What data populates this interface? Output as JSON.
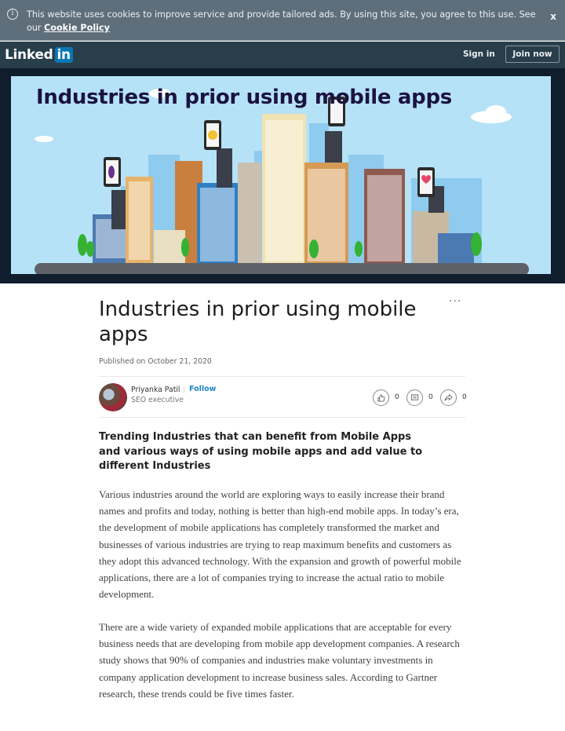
{
  "cookie_banner": {
    "info_icon": "info-circle-icon",
    "text": "This website uses cookies to improve service and provide tailored ads. By using this site, you agree to this use. See our ",
    "link_label": "Cookie Policy",
    "close_label": "x"
  },
  "nav": {
    "logo_text": "Linked",
    "logo_badge": "in",
    "sign_in_label": "Sign in",
    "join_now_label": "Join now"
  },
  "hero": {
    "banner_title": "Industries in prior using mobile apps",
    "colors": {
      "sky": "#b6e2f7",
      "frame": "#0f1d2c",
      "title": "#1a1340"
    }
  },
  "article": {
    "more_icon": "more-horizontal-icon",
    "more_label": "...",
    "title": "Industries in prior using mobile apps",
    "published": "Published on October 21, 2020",
    "author": {
      "name": "Priyanka Patil",
      "follow_label": "Follow",
      "role": "SEO executive"
    },
    "social": [
      {
        "icon": "like-icon",
        "count": "0"
      },
      {
        "icon": "comment-icon",
        "count": "0"
      },
      {
        "icon": "share-icon",
        "count": "0"
      }
    ],
    "subheading": "Trending Industries that can benefit from Mobile Apps and various ways of using mobile apps and add value to different Industries",
    "paragraphs": [
      "Various industries around the world are exploring ways to easily increase their brand names and profits and today, nothing is better than high-end mobile apps. In today’s era, the development of mobile applications has completely transformed the market and businesses of various industries are trying to reap maximum benefits and customers as they adopt this advanced technology. With the expansion and growth of powerful mobile applications, there are a lot of companies trying to increase the actual ratio to mobile development.",
      "There are a wide variety of expanded mobile applications that are acceptable for every business needs that are developing from mobile app development companies. A research study shows that 90% of companies and industries make voluntary investments in company application development to increase business sales. According to Gartner research, these trends could be five times faster."
    ]
  },
  "colors": {
    "cookie_bg": "#5e6e7b",
    "nav_bg": "#283e4a",
    "brand_blue": "#0a77b5",
    "follow_blue": "#1e87c5"
  }
}
